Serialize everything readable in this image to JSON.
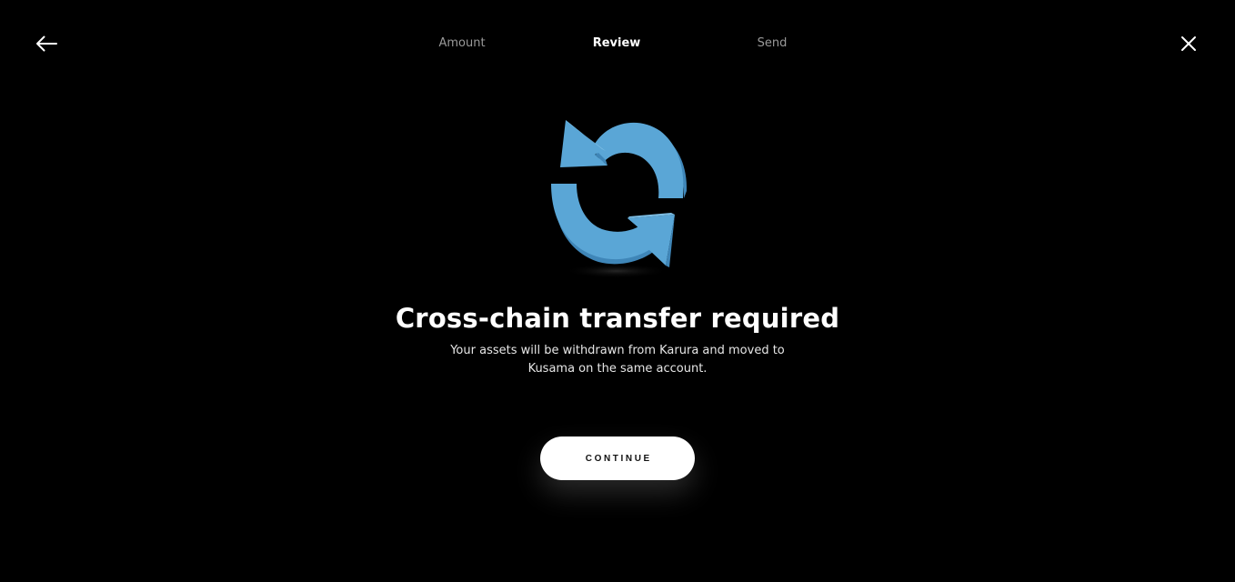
{
  "nav": {
    "back_icon": "arrow-left-icon",
    "close_icon": "close-icon"
  },
  "steps": [
    {
      "label": "Amount",
      "state": "inactive"
    },
    {
      "label": "Review",
      "state": "active"
    },
    {
      "label": "Send",
      "state": "inactive"
    }
  ],
  "hero": {
    "icon": "refresh-arrows-icon"
  },
  "content": {
    "title": "Cross-chain transfer required",
    "subtitle": "Your assets will be withdrawn from Karura and moved to Kusama on the same account."
  },
  "actions": {
    "continue_label": "CONTINUE"
  },
  "colors": {
    "background": "#000000",
    "text": "#ffffff",
    "inactive_step": "#9a9a9a",
    "icon_blue": "#5aa6d6",
    "button_bg": "#ffffff",
    "button_text": "#111111"
  }
}
